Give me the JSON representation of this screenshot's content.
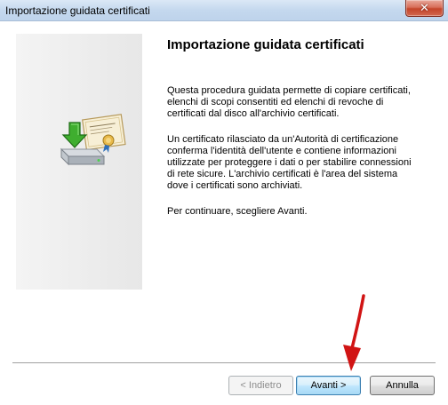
{
  "window": {
    "title": "Importazione guidata certificati",
    "close_icon": "close-icon"
  },
  "side_panel": {
    "icon": "certificate-import-icon"
  },
  "content": {
    "heading": "Importazione guidata certificati",
    "paragraph1": "Questa procedura guidata permette di copiare certificati,\nelenchi di scopi consentiti ed elenchi di revoche di\ncertificati dal disco all'archivio certificati.",
    "paragraph2": "Un certificato rilasciato da un'Autorità di certificazione\nconferma l'identità dell'utente e contiene informazioni\nutilizzate per proteggere i dati o per stabilire connessioni\ndi rete sicure. L'archivio certificati è l'area del sistema\ndove i certificati sono archiviati.",
    "paragraph3": "Per continuare, scegliere Avanti."
  },
  "buttons": {
    "back_label": "< Indietro",
    "next_label": "Avanti >",
    "cancel_label": "Annulla"
  },
  "annotation": {
    "arrow_icon": "red-arrow-icon",
    "color": "#d11414"
  }
}
